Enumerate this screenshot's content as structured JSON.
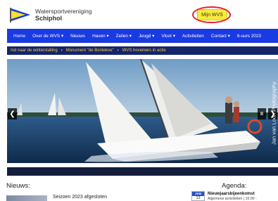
{
  "header": {
    "brand_line1": "Watersportvereniging",
    "brand_line2": "Schiphol",
    "my_wvs_label": "Mijn WVS"
  },
  "nav": {
    "items": [
      "Home",
      "Over de WVS ▾",
      "Nieuws",
      "Haven ▾",
      "Zeilen ▾",
      "Jeugd ▾",
      "Vloot ▾",
      "Activiteiten",
      "Contact ▾",
      "6-uurs 2023"
    ]
  },
  "breadcrumb": {
    "items": [
      "Ind naar de winterstalling",
      "Monument \"de Bontekoe\"",
      "WVS hoveniers in actie"
    ],
    "separator": "›"
  },
  "slider": {
    "prev": "❮",
    "next": "❯",
    "pause": "II",
    "credit": "Jan van Loon Photography"
  },
  "news": {
    "title": "Nieuws:",
    "items": [
      {
        "title": "Seizoen 2023 afgesloten"
      }
    ]
  },
  "agenda": {
    "title": "Agenda:",
    "events": [
      {
        "month": "JAN",
        "day": "13",
        "title": "Nieuwjaarsbijeenkomst",
        "meta": "Algemene activiteiten | 16:00 -"
      }
    ]
  },
  "colors": {
    "nav_bg": "#1a3ae2",
    "breadcrumb_bg": "#16246a",
    "breadcrumb_text": "#f2d13a",
    "mywvs_bg": "#f7ea3a",
    "highlight_ring": "#e8202a"
  }
}
